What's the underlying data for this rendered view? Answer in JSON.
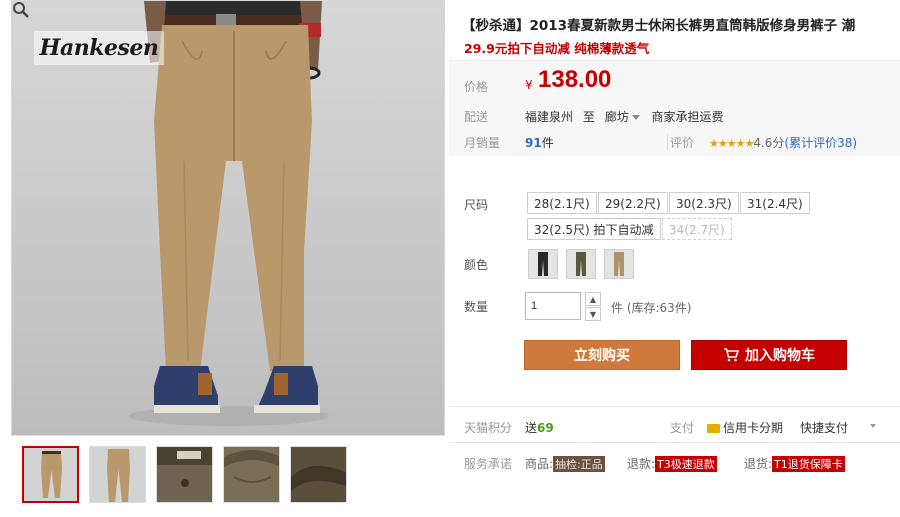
{
  "product": {
    "title": "【秒杀通】2013春夏新款男士休闲长裤男直筒韩版修身男裤子 潮",
    "subtitle": "29.9元拍下自动减 纯棉薄款透气",
    "brand_logo": "Hankesen"
  },
  "price": {
    "label": "价格",
    "currency": "¥",
    "value": "138.00"
  },
  "shipping": {
    "label": "配送",
    "from": "福建泉州",
    "to_word": "至",
    "to": "廊坊",
    "fee": "商家承担运费"
  },
  "sales": {
    "label": "月销量",
    "count": "91",
    "unit": "件",
    "rating_label": "评价",
    "stars": "★★★★★",
    "rating_score": "4.6分",
    "review_link": "(累计评价38)"
  },
  "sizes": {
    "label": "尺码",
    "options": [
      {
        "label": "28(2.1尺)",
        "available": true
      },
      {
        "label": "29(2.2尺)",
        "available": true
      },
      {
        "label": "30(2.3尺)",
        "available": true
      },
      {
        "label": "31(2.4尺)",
        "available": true
      },
      {
        "label": "32(2.5尺) 拍下自动减",
        "available": true
      },
      {
        "label": "34(2.7尺)",
        "available": false
      }
    ]
  },
  "colors": {
    "label": "颜色",
    "swatch_colors": [
      "#2a2a2a",
      "#5b5a3c",
      "#b0926a"
    ]
  },
  "quantity": {
    "label": "数量",
    "value": "1",
    "unit_stock": "件 (库存:63件)"
  },
  "actions": {
    "buy_now": "立刻购买",
    "add_to_cart": "加入购物车"
  },
  "points": {
    "label": "天猫积分",
    "send": "送",
    "amount": "69",
    "pay_label": "支付",
    "credit": "信用卡分期",
    "quick_pay": "快捷支付"
  },
  "service": {
    "label": "服务承诺",
    "goods": "商品:",
    "goods_tag": "抽检:正品",
    "return": "退款:",
    "return_tag": "T3极速退款",
    "exchange": "退货:",
    "exchange_tag": "T1退货保障卡"
  },
  "theme": {
    "accent": "#c40000",
    "buy_button": "#cf7a3a"
  }
}
